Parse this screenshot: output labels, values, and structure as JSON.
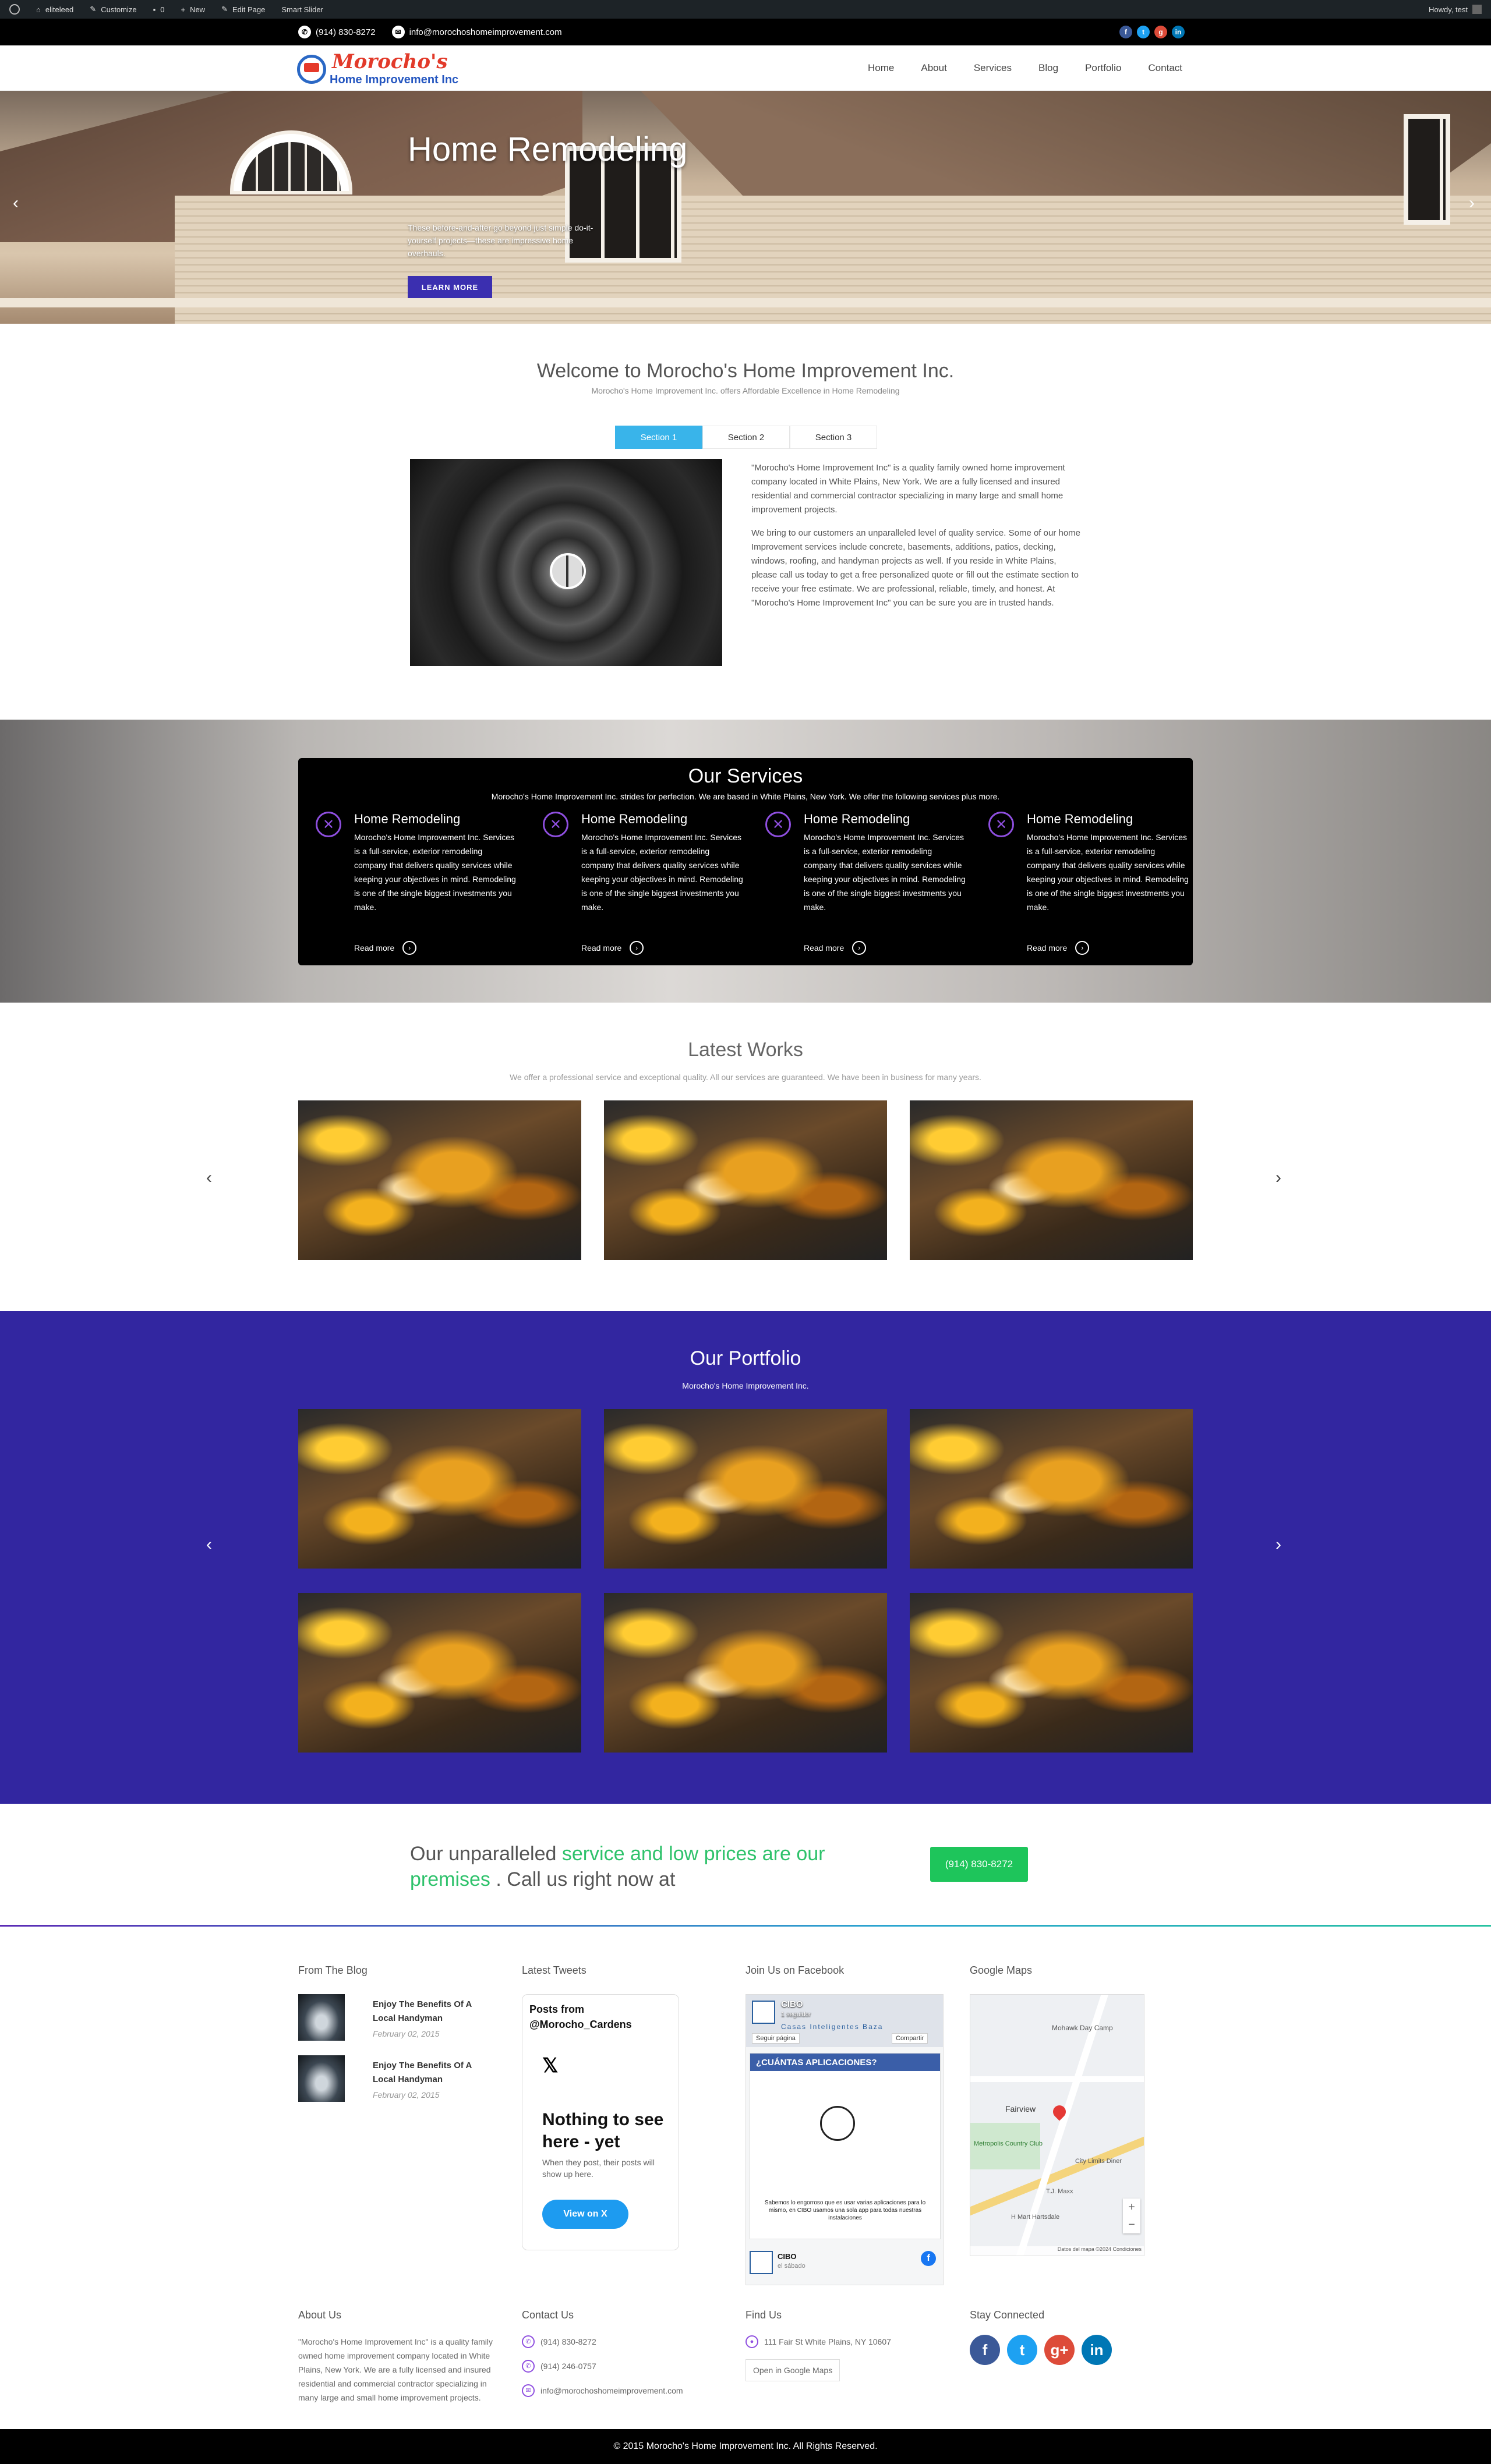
{
  "admin_bar": {
    "site": "eliteleed",
    "customize": "Customize",
    "comments": "0",
    "new": "New",
    "edit": "Edit Page",
    "slider": "Smart Slider",
    "howdy": "Howdy, test"
  },
  "topbar": {
    "phone": "(914) 830-8272",
    "email": "info@morochoshomeimprovement.com",
    "social_icons": [
      "facebook-icon",
      "twitter-icon",
      "google-plus-icon",
      "linkedin-icon"
    ]
  },
  "header": {
    "logo_line1": "Morocho's",
    "logo_line2": "Home Improvement Inc",
    "nav": [
      "Home",
      "About",
      "Services",
      "Blog",
      "Portfolio",
      "Contact"
    ]
  },
  "hero": {
    "title": "Home Remodeling",
    "text": "These before-and-after go beyond just simple do-it-yourself projects—these are impressive home overhauls.",
    "button": "LEARN MORE"
  },
  "welcome": {
    "title": "Welcome to Morocho's Home Improvement Inc.",
    "subtitle": "Morocho's Home Improvement Inc. offers Affordable Excellence in Home Remodeling",
    "tabs": [
      "Section 1",
      "Section 2",
      "Section 3"
    ],
    "para1": "\"Morocho's Home Improvement Inc\" is a quality family owned home improvement company located in White Plains, New York. We are a fully licensed and insured residential and commercial contractor specializing in many large and small home improvement projects.",
    "para2": "We bring to our customers an unparalleled level of quality service. Some of our home Improvement services include concrete, basements, additions, patios, decking, windows, roofing, and handyman projects as well. If you reside in White Plains, please call us today to get a free personalized quote or fill out the estimate section to receive your free estimate. We are professional, reliable, timely, and honest. At \"Morocho's Home Improvement Inc\" you can be sure you are in trusted hands."
  },
  "services": {
    "title": "Our Services",
    "subtitle": "Morocho's Home Improvement Inc. strides for perfection. We are based in White Plains, New York. We offer the following services plus more.",
    "items": [
      {
        "title": "Home Remodeling",
        "text": "Morocho's Home Improvement Inc. Services is a full-service, exterior remodeling company that delivers quality services while keeping your objectives in mind. Remodeling is one of the single biggest investments you make.",
        "more": "Read more"
      },
      {
        "title": "Home Remodeling",
        "text": "Morocho's Home Improvement Inc. Services is a full-service, exterior remodeling company that delivers quality services while keeping your objectives in mind. Remodeling is one of the single biggest investments you make.",
        "more": "Read more"
      },
      {
        "title": "Home Remodeling",
        "text": "Morocho's Home Improvement Inc. Services is a full-service, exterior remodeling company that delivers quality services while keeping your objectives in mind. Remodeling is one of the single biggest investments you make.",
        "more": "Read more"
      },
      {
        "title": "Home Remodeling",
        "text": "Morocho's Home Improvement Inc. Services is a full-service, exterior remodeling company that delivers quality services while keeping your objectives in mind. Remodeling is one of the single biggest investments you make.",
        "more": "Read more"
      }
    ]
  },
  "works": {
    "title": "Latest Works",
    "subtitle": "We offer a professional service and exceptional quality. All our services are guaranteed. We have been in business for many years."
  },
  "portfolio": {
    "title": "Our Portfolio",
    "subtitle": "Morocho's Home Improvement Inc."
  },
  "cta": {
    "text_a": "Our unparalleled ",
    "text_b": "service and low prices are our premises",
    "text_c": " . Call us right now at",
    "button": "(914) 830-8272"
  },
  "footer": {
    "blog_heading": "From The Blog",
    "posts": [
      {
        "title": "Enjoy The Benefits Of A Local Handyman",
        "date": "February 02, 2015"
      },
      {
        "title": "Enjoy The Benefits Of A Local Handyman",
        "date": "February 02, 2015"
      }
    ],
    "tweets_heading": "Latest Tweets",
    "tweets": {
      "header": "Posts from @Morocho_Cardens",
      "logo": "𝕏",
      "big": "Nothing to see here - yet",
      "small": "When they post, their posts will show up here.",
      "button": "View on X"
    },
    "facebook_heading": "Join Us on Facebook",
    "facebook": {
      "page_name": "CIBO",
      "followers": "1 seguidor",
      "follow": "Seguir página",
      "share": "Compartir",
      "banner": "Casas Inteligentes Baza",
      "question": "¿CUÁNTAS APLICACIONES?",
      "caption": "Sabemos lo engorroso que es usar varias aplicaciones para lo mismo, en CIBO usamos una sola app para todas nuestras instalaciones",
      "post_name": "CIBO",
      "post_time": "el sábado"
    },
    "maps_heading": "Google Maps",
    "map": {
      "labels": [
        "Mohawk Day Camp",
        "Fairview",
        "Metropolis Country Club",
        "City Limits Diner",
        "T.J. Maxx",
        "H Mart Hartsdale"
      ],
      "footer": "Datos del mapa ©2024   Condiciones"
    },
    "about_heading": "About Us",
    "about_text": "\"Morocho's Home Improvement Inc\" is a quality family owned home improvement company located in White Plains, New York. We are a fully licensed and insured residential and commercial contractor specializing in many large and small home improvement projects.",
    "contact_heading": "Contact Us",
    "phone1": "(914) 830-8272",
    "phone2": "(914) 246-0757",
    "email": "info@morochoshomeimprovement.com",
    "find_heading": "Find Us",
    "address": "111 Fair St White Plains, NY 10607",
    "open_maps": "Open in Google Maps",
    "stay_heading": "Stay Connected",
    "social_icons": [
      "facebook-icon",
      "twitter-icon",
      "google-plus-icon",
      "linkedin-icon"
    ]
  },
  "copyright": "© 2015 Morocho's Home Improvement Inc. All Rights Reserved.",
  "colors": {
    "accent_purple": "#3226a0",
    "tab_blue": "#39b4ea",
    "cta_green": "#1ec55b",
    "service_icon_purple": "#8f4fe0"
  }
}
